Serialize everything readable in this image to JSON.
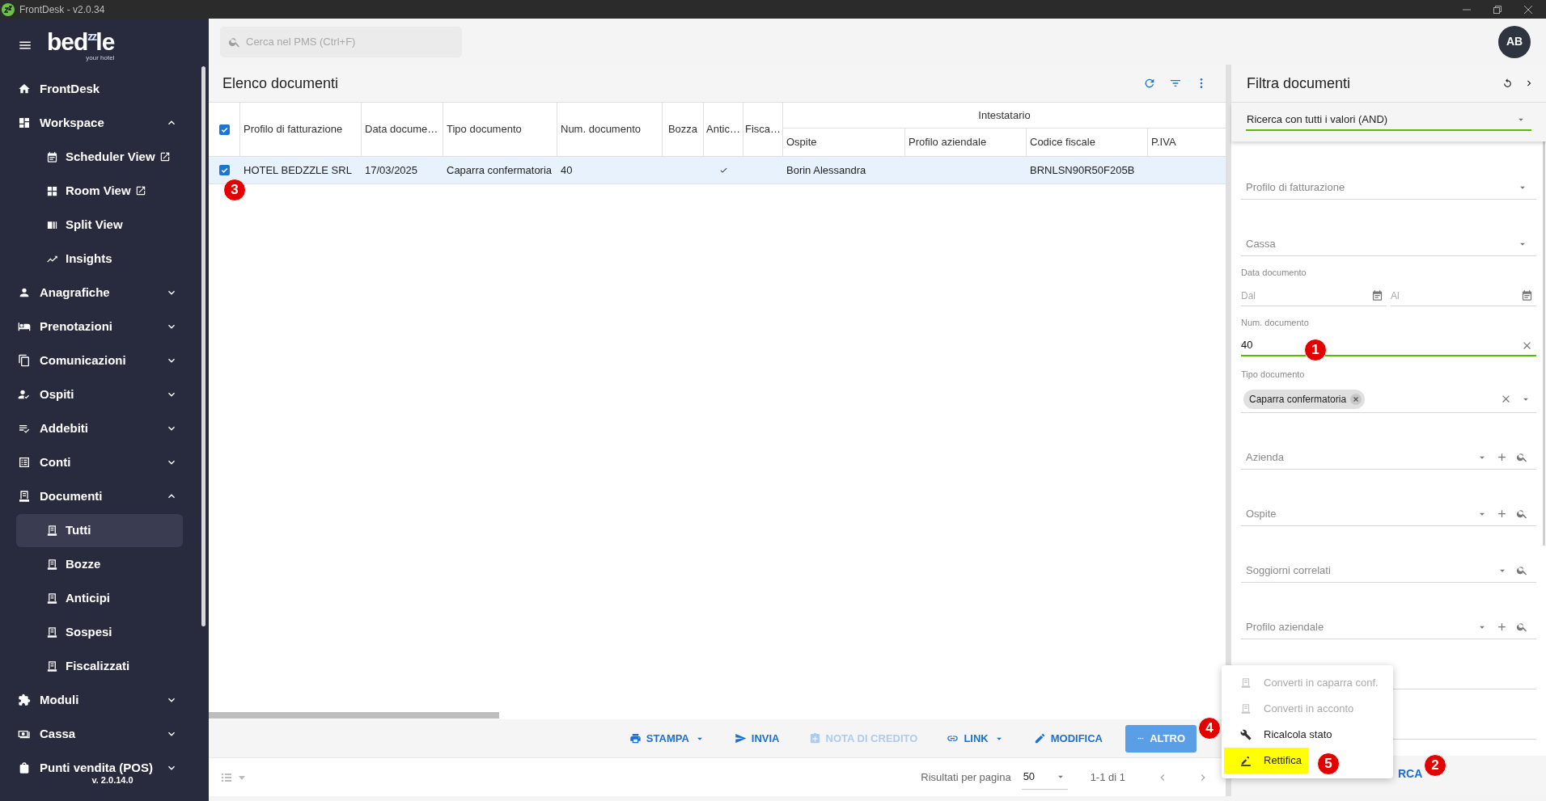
{
  "window": {
    "title": "FrontDesk - v2.0.34"
  },
  "logo": {
    "parts": [
      "bed",
      "zz",
      "le"
    ],
    "tagline": "your hotel"
  },
  "sidebar": {
    "items": [
      {
        "label": "FrontDesk"
      },
      {
        "label": "Workspace",
        "expanded": true,
        "children": [
          {
            "label": "Scheduler View",
            "external": true,
            "selected": false
          },
          {
            "label": "Room View",
            "external": true,
            "selected": false
          },
          {
            "label": "Split View",
            "external": false,
            "selected": false
          },
          {
            "label": "Insights",
            "external": false,
            "selected": false
          }
        ]
      },
      {
        "label": "Anagrafiche",
        "expanded": false
      },
      {
        "label": "Prenotazioni",
        "expanded": false
      },
      {
        "label": "Comunicazioni",
        "expanded": false
      },
      {
        "label": "Ospiti",
        "expanded": false
      },
      {
        "label": "Addebiti",
        "expanded": false
      },
      {
        "label": "Conti",
        "expanded": false
      },
      {
        "label": "Documenti",
        "expanded": true,
        "children": [
          {
            "label": "Tutti",
            "external": false,
            "selected": true
          },
          {
            "label": "Bozze",
            "external": false,
            "selected": false
          },
          {
            "label": "Anticipi",
            "external": false,
            "selected": false
          },
          {
            "label": "Sospesi",
            "external": false,
            "selected": false
          },
          {
            "label": "Fiscalizzati",
            "external": false,
            "selected": false
          }
        ]
      },
      {
        "label": "Moduli",
        "expanded": false
      },
      {
        "label": "Cassa",
        "expanded": false
      },
      {
        "label": "Punti vendita (POS)",
        "expanded": false,
        "version": "v. 2.0.14.0"
      }
    ]
  },
  "search": {
    "placeholder": "Cerca nel PMS (Ctrl+F)"
  },
  "avatar": {
    "initials": "AB"
  },
  "documents": {
    "title": "Elenco documenti",
    "table": {
      "all_checked": true,
      "columns": [
        {
          "label": "Profilo di fatturazione",
          "kind": "text"
        },
        {
          "label": "Data docume…",
          "kind": "text"
        },
        {
          "label": "Tipo documento",
          "kind": "text"
        },
        {
          "label": "Num. documento",
          "kind": "text"
        },
        {
          "label": "Bozza",
          "kind": "flag"
        },
        {
          "label": "Antic…",
          "kind": "flag"
        },
        {
          "label": "Fisca…",
          "kind": "flag"
        }
      ],
      "column_group": {
        "label": "Intestatario",
        "columns": [
          {
            "label": "Ospite",
            "kind": "text"
          },
          {
            "label": "Profilo aziendale",
            "kind": "text"
          },
          {
            "label": "Codice fiscale",
            "kind": "text"
          },
          {
            "label": "P.IVA",
            "kind": "text"
          }
        ]
      },
      "rows": [
        {
          "selected": true,
          "checked": true,
          "cells": [
            "HOTEL BEDZZLE SRL",
            "17/03/2025",
            "Caparra confermatoria",
            "40",
            false,
            true,
            false,
            "Borin Alessandra",
            null,
            "BRNLSN90R50F205B",
            null
          ]
        }
      ]
    },
    "actions": [
      {
        "label": "STAMPA",
        "dropdown": true,
        "disabled": false,
        "kind": "text"
      },
      {
        "label": "INVIA",
        "dropdown": false,
        "disabled": false,
        "kind": "text"
      },
      {
        "label": "NOTA DI CREDITO",
        "dropdown": false,
        "disabled": true,
        "kind": "text"
      },
      {
        "label": "LINK",
        "dropdown": true,
        "disabled": false,
        "kind": "text"
      },
      {
        "label": "MODIFICA",
        "dropdown": false,
        "disabled": false,
        "kind": "text"
      },
      {
        "label": "ALTRO",
        "dropdown": false,
        "disabled": false,
        "kind": "filled"
      }
    ],
    "pagination": {
      "per_page_label": "Risultati per pagina",
      "per_page": "50",
      "range": "1-1 di 1"
    }
  },
  "filters": {
    "title": "Filtra documenti",
    "mode": "Ricerca con tutti i valori (AND)",
    "fields": [
      {
        "kind": "select",
        "placeholder": "Profilo di fatturazione"
      },
      {
        "kind": "select",
        "placeholder": "Cassa"
      },
      {
        "kind": "daterange",
        "label": "Data documento",
        "from": "Dal",
        "to": "Al"
      },
      {
        "kind": "text",
        "label": "Num. documento",
        "value": "40"
      },
      {
        "kind": "chips",
        "label": "Tipo documento",
        "chips": [
          "Caparra confermatoria"
        ]
      },
      {
        "kind": "lookup",
        "placeholder": "Azienda",
        "addable": true
      },
      {
        "kind": "lookup",
        "placeholder": "Ospite",
        "addable": true
      },
      {
        "kind": "lookup",
        "placeholder": "Soggiorni correlati",
        "addable": false
      },
      {
        "kind": "lookup",
        "placeholder": "Profilo aziendale",
        "addable": true
      },
      {
        "kind": "blank"
      },
      {
        "kind": "blank"
      }
    ],
    "search_button": "RCA"
  },
  "menu": {
    "items": [
      {
        "label": "Converti in caparra conf.",
        "disabled": true,
        "highlighted": false
      },
      {
        "label": "Converti in acconto",
        "disabled": true,
        "highlighted": false
      },
      {
        "label": "Ricalcola stato",
        "disabled": false,
        "highlighted": false
      },
      {
        "label": "Rettifica",
        "disabled": false,
        "highlighted": true
      }
    ]
  },
  "annotations": [
    {
      "label": "1"
    },
    {
      "label": "2"
    },
    {
      "label": "3"
    },
    {
      "label": "4"
    },
    {
      "label": "5"
    }
  ]
}
